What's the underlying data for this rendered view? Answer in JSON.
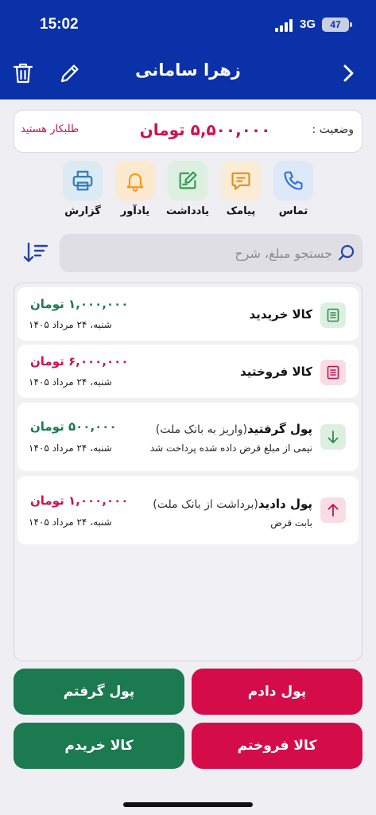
{
  "status_bar": {
    "time": "15:02",
    "network": "3G",
    "battery": "47"
  },
  "header": {
    "title": "زهرا سامانی"
  },
  "balance": {
    "label": "وضعیت :",
    "amount": "۵,۵۰۰,۰۰۰ تومان",
    "status": "طلبکار هستید"
  },
  "actions": [
    {
      "label": "تماس",
      "icon": "phone-icon",
      "color": "#2f6fdc",
      "bg": "#dde8f8"
    },
    {
      "label": "پیامک",
      "icon": "message-icon",
      "color": "#e0900f",
      "bg": "#fbecd6"
    },
    {
      "label": "یادداشت",
      "icon": "note-icon",
      "color": "#2e9a4e",
      "bg": "#dcefe0"
    },
    {
      "label": "یادآور",
      "icon": "bell-icon",
      "color": "#f39a12",
      "bg": "#fde8d0"
    },
    {
      "label": "گزارش",
      "icon": "printer-icon",
      "color": "#2f7fc0",
      "bg": "#dceaf4"
    }
  ],
  "search": {
    "placeholder": "جستجو مبلغ، شرح"
  },
  "transactions": [
    {
      "title": "کالا خریدید",
      "note": "",
      "description": "",
      "amount": "۱,۰۰۰,۰۰۰ تومان",
      "amount_color": "#1a7a4e",
      "date": "شنبه، ۲۴ مرداد ۱۴۰۵",
      "icon": "receipt-icon",
      "icon_color": "#2e8a50",
      "icon_bg": "#dcefe0"
    },
    {
      "title": "کالا فروختید",
      "note": "",
      "description": "",
      "amount": "۶,۰۰۰,۰۰۰ تومان",
      "amount_color": "#d0104c",
      "date": "شنبه، ۲۴ مرداد ۱۴۰۵",
      "icon": "receipt-icon",
      "icon_color": "#c8104c",
      "icon_bg": "#f8dde5"
    },
    {
      "title": "پول گرفتید",
      "note": "(واریز به بانک ملت)",
      "description": "نیمی از مبلغ قرض داده شده پرداخت شد",
      "amount": "۵۰۰,۰۰۰ تومان",
      "amount_color": "#1a7a4e",
      "date": "شنبه، ۲۴ مرداد ۱۴۰۵",
      "icon": "arrow-down-icon",
      "icon_color": "#2e8a50",
      "icon_bg": "#dcefe0"
    },
    {
      "title": "پول دادید",
      "note": "(برداشت از بانک ملت)",
      "description": "بابت قرض",
      "amount": "۱,۰۰۰,۰۰۰ تومان",
      "amount_color": "#d0104c",
      "date": "شنبه، ۲۴ مرداد ۱۴۰۵",
      "icon": "arrow-up-icon",
      "icon_color": "#c8104c",
      "icon_bg": "#f8dde5"
    }
  ],
  "buttons": {
    "paid": "پول دادم",
    "received": "پول گرفتم",
    "sold": "کالا فروختم",
    "bought": "کالا خریدم",
    "red": "#d40d4a",
    "green": "#1b7a4f"
  }
}
